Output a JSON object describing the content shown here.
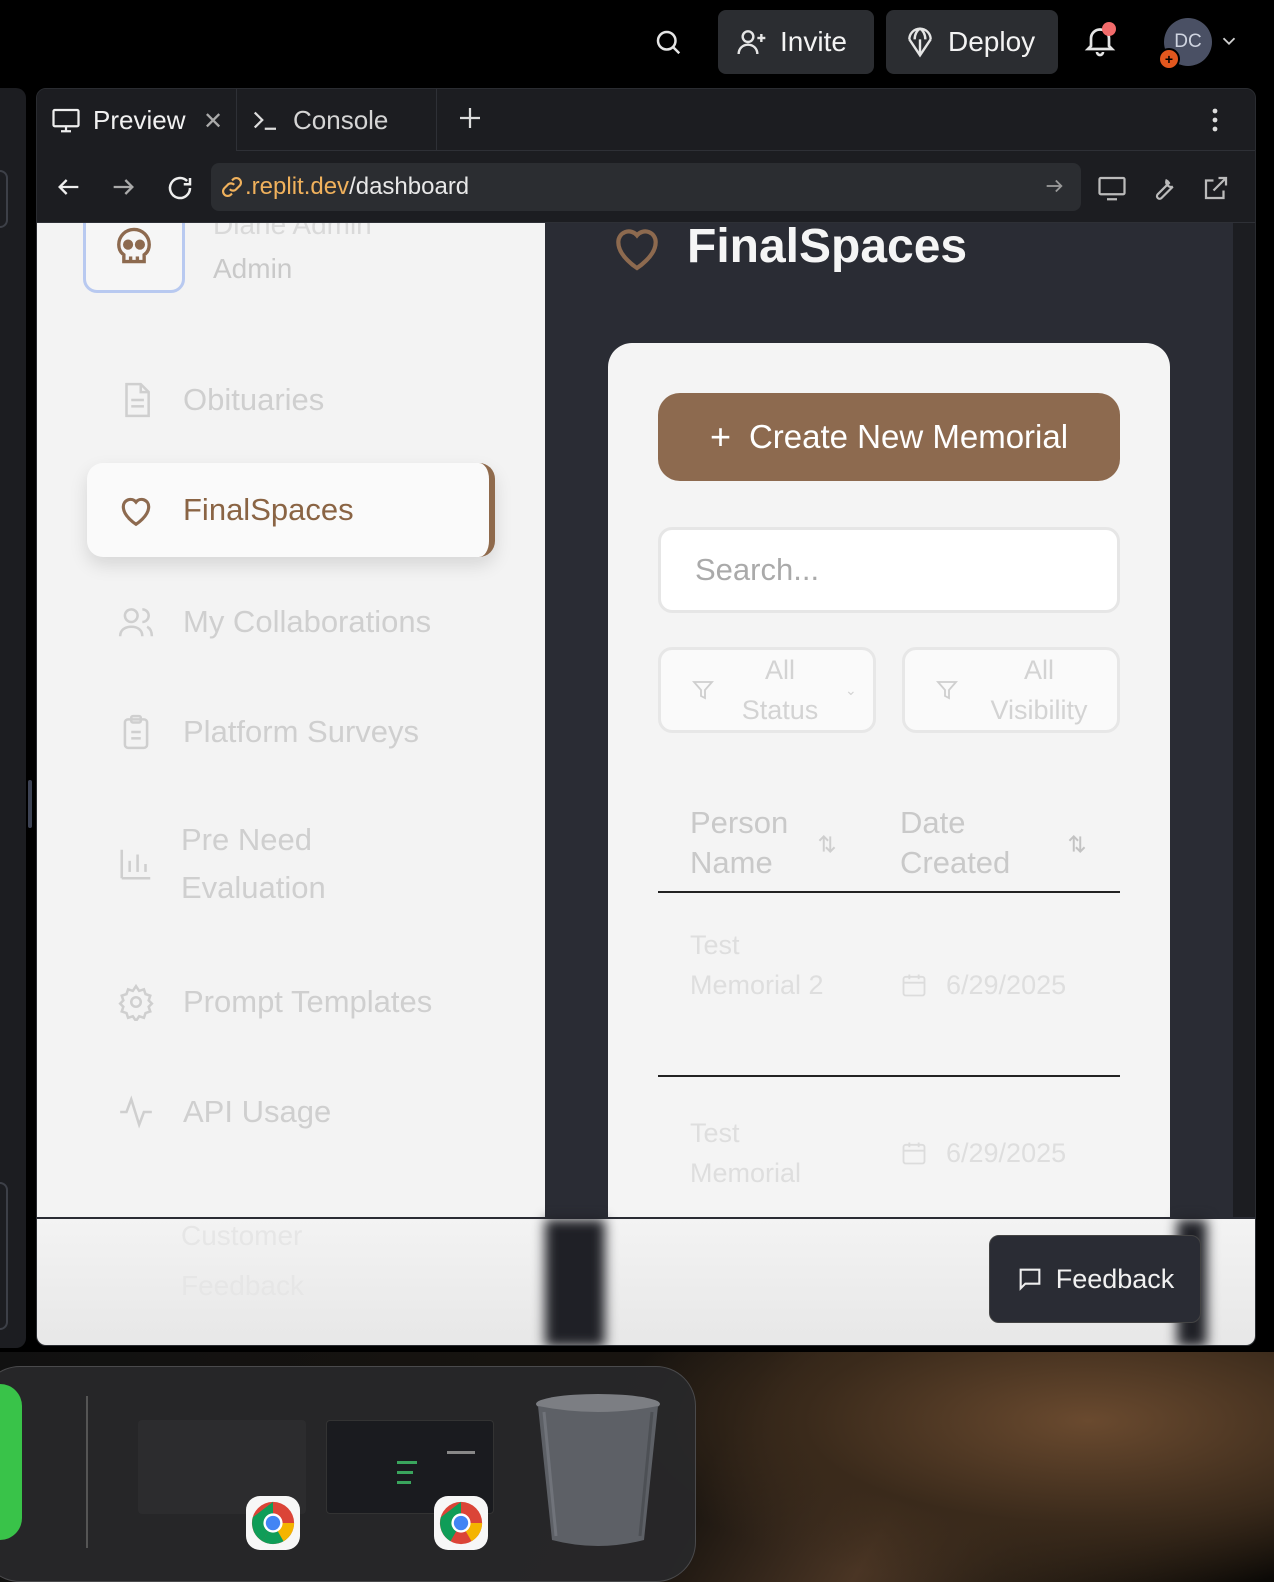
{
  "topbar": {
    "invite_label": "Invite",
    "deploy_label": "Deploy",
    "avatar_initials": "DC"
  },
  "tabs": {
    "preview_label": "Preview",
    "console_label": "Console"
  },
  "urlbar": {
    "host": ".replit.dev",
    "path": "/dashboard"
  },
  "sidebar": {
    "user_name": "Diane Admin",
    "user_role": "Admin",
    "items": [
      {
        "label": "Obituaries",
        "icon": "document-icon"
      },
      {
        "label": "FinalSpaces",
        "icon": "heart-icon"
      },
      {
        "label": "My Collaborations",
        "icon": "users-icon"
      },
      {
        "label": "Platform Surveys",
        "icon": "clipboard-icon"
      },
      {
        "label": "Pre Need Evaluation",
        "icon": "bar-chart-icon"
      },
      {
        "label": "Prompt Templates",
        "icon": "gear-icon"
      },
      {
        "label": "API Usage",
        "icon": "activity-icon"
      },
      {
        "label": "Customer Feedback",
        "icon": "message-icon"
      }
    ]
  },
  "main": {
    "title": "FinalSpaces",
    "create_label": "Create New Memorial",
    "search_placeholder": "Search...",
    "filter_status": "All Status",
    "filter_visibility": "All Visibility",
    "col_name": "Person Name",
    "col_date": "Date Created",
    "rows": [
      {
        "name": "Test Memorial 2",
        "date": "6/29/2025"
      },
      {
        "name": "Test Memorial",
        "date": "6/29/2025"
      }
    ]
  },
  "feedback_label": "Feedback",
  "colors": {
    "accent": "#8d6a4f",
    "sidebar_bg": "#f3f3f3",
    "main_bg": "#2a2c34",
    "url_host": "#f0b15c"
  }
}
